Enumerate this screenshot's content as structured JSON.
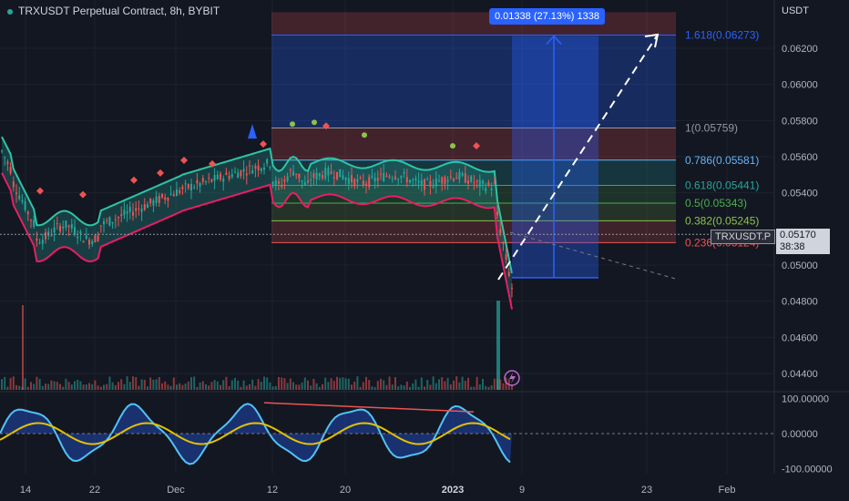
{
  "header": {
    "title": "TRXUSDT Perpetual Contract, 8h, BYBIT"
  },
  "axis": {
    "unit": "USDT"
  },
  "price": {
    "symbol": "TRXUSDT.P",
    "last": "0.05170",
    "countdown": "38:38"
  },
  "measure": {
    "label": "0.01338 (27.13%) 1338"
  },
  "colors": {
    "up": "#26a69a",
    "down": "#ef5350",
    "accent": "#2962ff",
    "bg": "#131722",
    "grid": "#1e222d",
    "text": "#b2b5be",
    "oscLine": "#4fc3f7",
    "oscSignal": "#e5c100"
  },
  "icons": {
    "alert": "lightning-icon"
  },
  "chart_data": [
    {
      "type": "candlestick",
      "title": "TRXUSDT Perpetual Contract, 8h, BYBIT",
      "x_ticks": [
        "14",
        "22",
        "Dec",
        "12",
        "20",
        "2023",
        "9",
        "23",
        "Feb"
      ],
      "y_ticks": [
        "0.06200",
        "0.06000",
        "0.05800",
        "0.05600",
        "0.05400",
        "0.05000",
        "0.04800",
        "0.04600",
        "0.04400"
      ],
      "ylim": [
        0.0432,
        0.0642
      ],
      "fib_levels": [
        {
          "label": "1.618(0.06273)",
          "value": 0.06273,
          "color": "#2962ff"
        },
        {
          "label": "1(0.05759)",
          "value": 0.05759,
          "color": "#9598a1"
        },
        {
          "label": "0.786(0.05581)",
          "value": 0.05581,
          "color": "#64b5f6"
        },
        {
          "label": "0.618(0.05441)",
          "value": 0.05441,
          "color": "#26a69a"
        },
        {
          "label": "0.5(0.05343)",
          "value": 0.05343,
          "color": "#4caf50"
        },
        {
          "label": "0.382(0.05245)",
          "value": 0.05245,
          "color": "#8bc34a"
        },
        {
          "label": "0.236(0.05124)",
          "value": 0.05124,
          "color": "#ef5350"
        }
      ],
      "last_price": 0.0517,
      "measured_move": {
        "from": 0.0493,
        "to": 0.06268,
        "change": 0.01338,
        "percent": 27.13
      }
    },
    {
      "type": "line",
      "y_ticks": [
        "100.00000",
        "0.00000",
        "-100.00000"
      ],
      "ylim": [
        -100,
        100
      ]
    }
  ]
}
